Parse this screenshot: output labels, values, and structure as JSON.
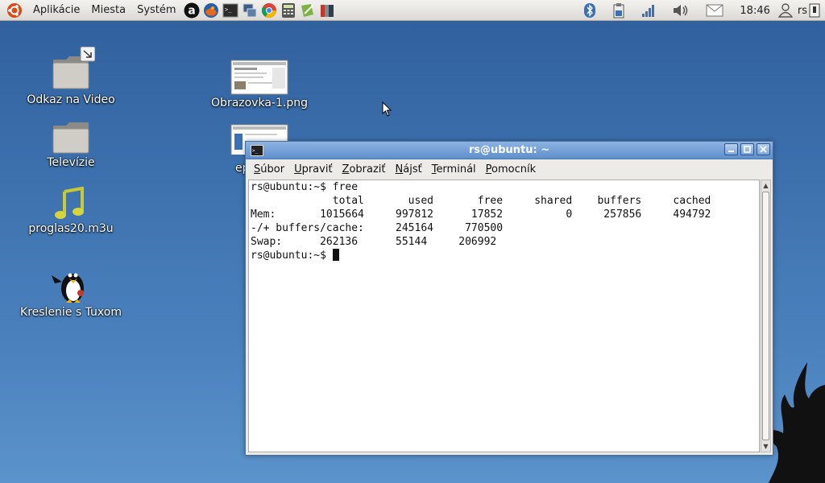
{
  "panel": {
    "menus": [
      "Aplikácie",
      "Miesta",
      "Systém"
    ],
    "launchers": [
      "amazon-icon",
      "firefox-icon",
      "terminal-icon",
      "monitor-icon",
      "chrome-icon",
      "calculator-icon",
      "gedit-icon",
      "books-icon"
    ],
    "clock": "18:46",
    "user": "rs"
  },
  "desktop": {
    "icons": [
      {
        "label": "Odkaz na Video",
        "icon": "folder-link-icon"
      },
      {
        "label": "Televízie",
        "icon": "folder-icon"
      },
      {
        "label": "proglas20.m3u",
        "icon": "music-note-icon"
      },
      {
        "label": "Kreslenie s Tuxom",
        "icon": "tux-icon"
      },
      {
        "label": "Obrazovka-1.png",
        "icon": "image-thumbnail-icon"
      },
      {
        "label": "ep",
        "icon": "image-thumbnail-icon"
      }
    ]
  },
  "window": {
    "title": "rs@ubuntu: ~",
    "menu": [
      {
        "accel": "S",
        "rest": "úbor"
      },
      {
        "accel": "U",
        "rest": "praviť"
      },
      {
        "accel": "Z",
        "rest": "obraziť"
      },
      {
        "accel": "N",
        "rest": "ájsť"
      },
      {
        "accel": "T",
        "rest": "erminál"
      },
      {
        "accel": "P",
        "rest": "omocník"
      }
    ],
    "terminal_lines": [
      "rs@ubuntu:~$ free",
      "             total       used       free     shared    buffers     cached",
      "Mem:       1015664     997812      17852          0     257856     494792",
      "-/+ buffers/cache:     245164     770500",
      "Swap:      262136      55144     206992"
    ],
    "prompt": "rs@ubuntu:~$ "
  },
  "colors": {
    "desktop": "#3c70ad",
    "titlebar": "#6f9bd4"
  }
}
